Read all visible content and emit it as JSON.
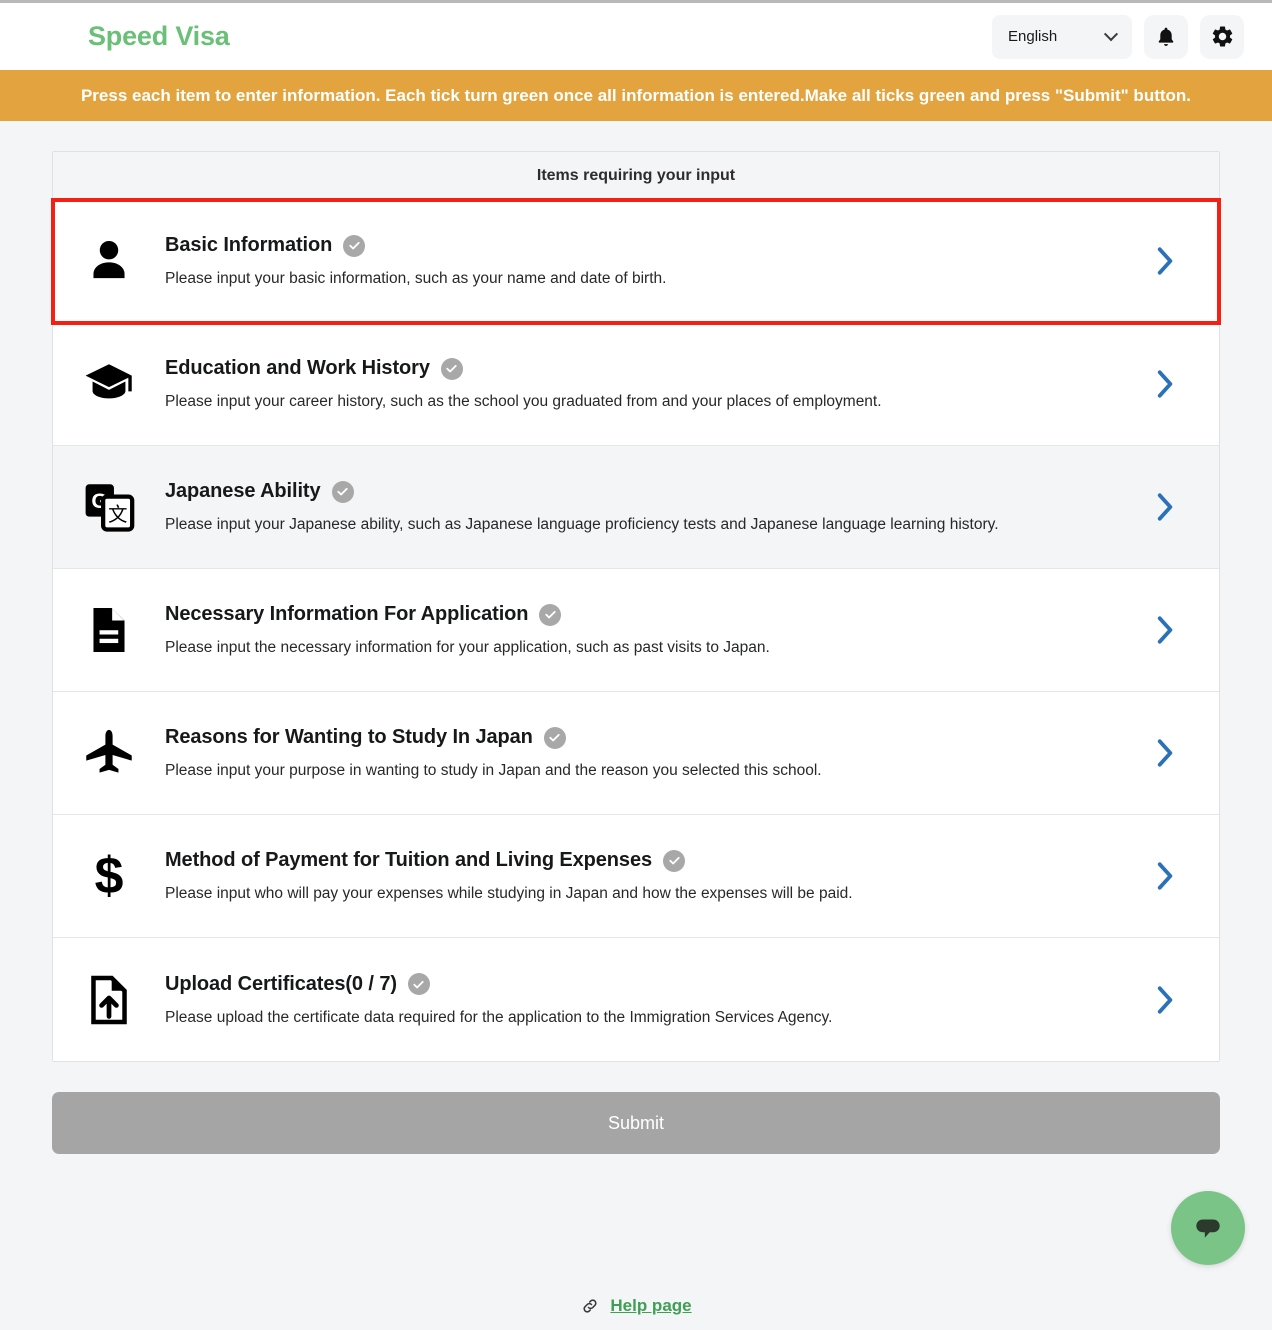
{
  "header": {
    "brand": "Speed Visa",
    "language": "English",
    "chevron_icon": "chevron-down-icon",
    "bell_icon": "bell-icon",
    "gear_icon": "gear-icon"
  },
  "banner": {
    "text": "Press each item to enter information. Each tick turn green once all information is entered.Make all ticks green and press \"Submit\" button.",
    "color": "#e3a33e"
  },
  "card": {
    "title": "Items requiring your input",
    "items": [
      {
        "icon": "person-icon",
        "title": "Basic Information",
        "description": "Please input your basic information, such as your name and date of birth.",
        "status": "incomplete",
        "highlighted": true,
        "shaded": false
      },
      {
        "icon": "graduation-cap-icon",
        "title": "Education and Work History",
        "description": "Please input your career history, such as the school you graduated from and your places of employment.",
        "status": "incomplete",
        "highlighted": false,
        "shaded": false
      },
      {
        "icon": "translate-icon",
        "title": "Japanese Ability",
        "description": "Please input your Japanese ability, such as Japanese language proficiency tests and Japanese language learning history.",
        "status": "incomplete",
        "highlighted": false,
        "shaded": true
      },
      {
        "icon": "document-icon",
        "title": "Necessary Information For Application",
        "description": "Please input the necessary information for your application, such as past visits to Japan.",
        "status": "incomplete",
        "highlighted": false,
        "shaded": false
      },
      {
        "icon": "airplane-icon",
        "title": "Reasons for Wanting to Study In Japan",
        "description": "Please input your purpose in wanting to study in Japan and the reason you selected this school.",
        "status": "incomplete",
        "highlighted": false,
        "shaded": false
      },
      {
        "icon": "dollar-icon",
        "title": "Method of Payment for Tuition and Living Expenses",
        "description": "Please input who will pay your expenses while studying in Japan and how the expenses will be paid.",
        "status": "incomplete",
        "highlighted": false,
        "shaded": false
      },
      {
        "icon": "file-upload-icon",
        "title": "Upload Certificates(0 / 7)",
        "description": "Please upload the certificate data required for the application to the Immigration Services Agency.",
        "status": "incomplete",
        "highlighted": false,
        "shaded": false
      }
    ],
    "chevron_icon": "chevron-right-icon",
    "chevron_color": "#2a71b8",
    "check_badge_color": "#a8a8a8"
  },
  "submit": {
    "label": "Submit",
    "enabled": false,
    "color": "#a5a5a5"
  },
  "footer": {
    "link_icon": "link-icon",
    "link_label": "Help page",
    "link_color": "#3f9f54"
  },
  "chat": {
    "icon": "chat-bubble-icon",
    "color": "#79c486"
  },
  "highlight": {
    "color": "#f32013"
  }
}
